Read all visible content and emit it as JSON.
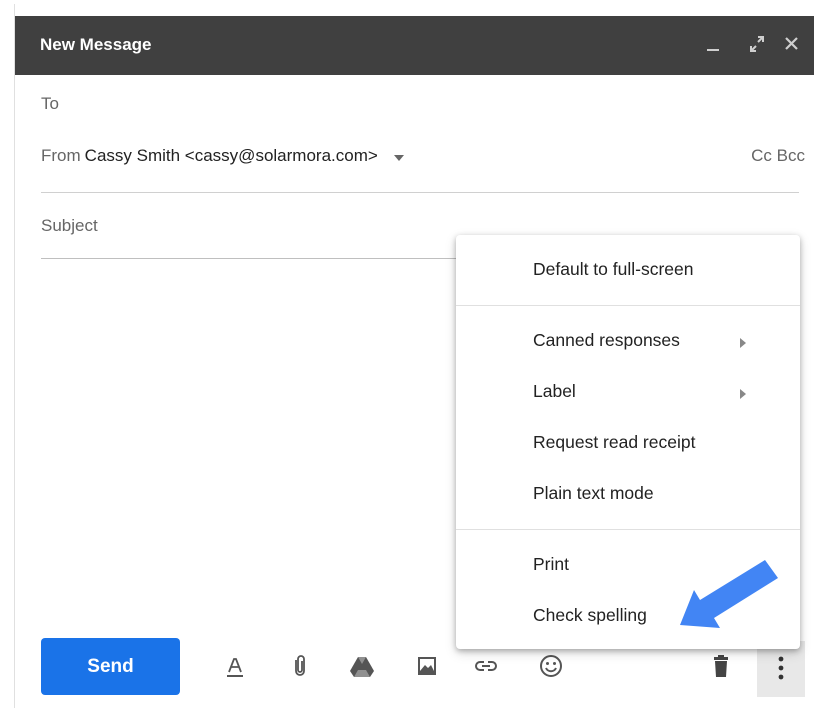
{
  "window": {
    "title": "New Message",
    "controls": [
      "minimize-icon",
      "expand-icon",
      "close-icon"
    ]
  },
  "fields": {
    "to_label": "To",
    "from_label": "From",
    "from_value": "Cassy Smith <cassy@solarmora.com>",
    "cc_bcc": "Cc Bcc",
    "subject_placeholder": "Subject"
  },
  "toolbar": {
    "send_label": "Send",
    "icons": [
      "formatting-icon",
      "attach-icon",
      "drive-icon",
      "insert-photo-icon",
      "insert-link-icon",
      "emoji-icon",
      "trash-icon",
      "more-options-icon"
    ]
  },
  "menu": {
    "items": [
      {
        "label": "Default to full-screen"
      },
      {
        "label": "Canned responses",
        "submenu": true
      },
      {
        "label": "Label",
        "submenu": true
      },
      {
        "label": "Request read receipt"
      },
      {
        "label": "Plain text mode"
      },
      {
        "label": "Print"
      },
      {
        "label": "Check spelling"
      }
    ]
  },
  "colors": {
    "titlebar": "#404040",
    "send": "#1a73e8",
    "annotation_arrow": "#4285f4"
  }
}
